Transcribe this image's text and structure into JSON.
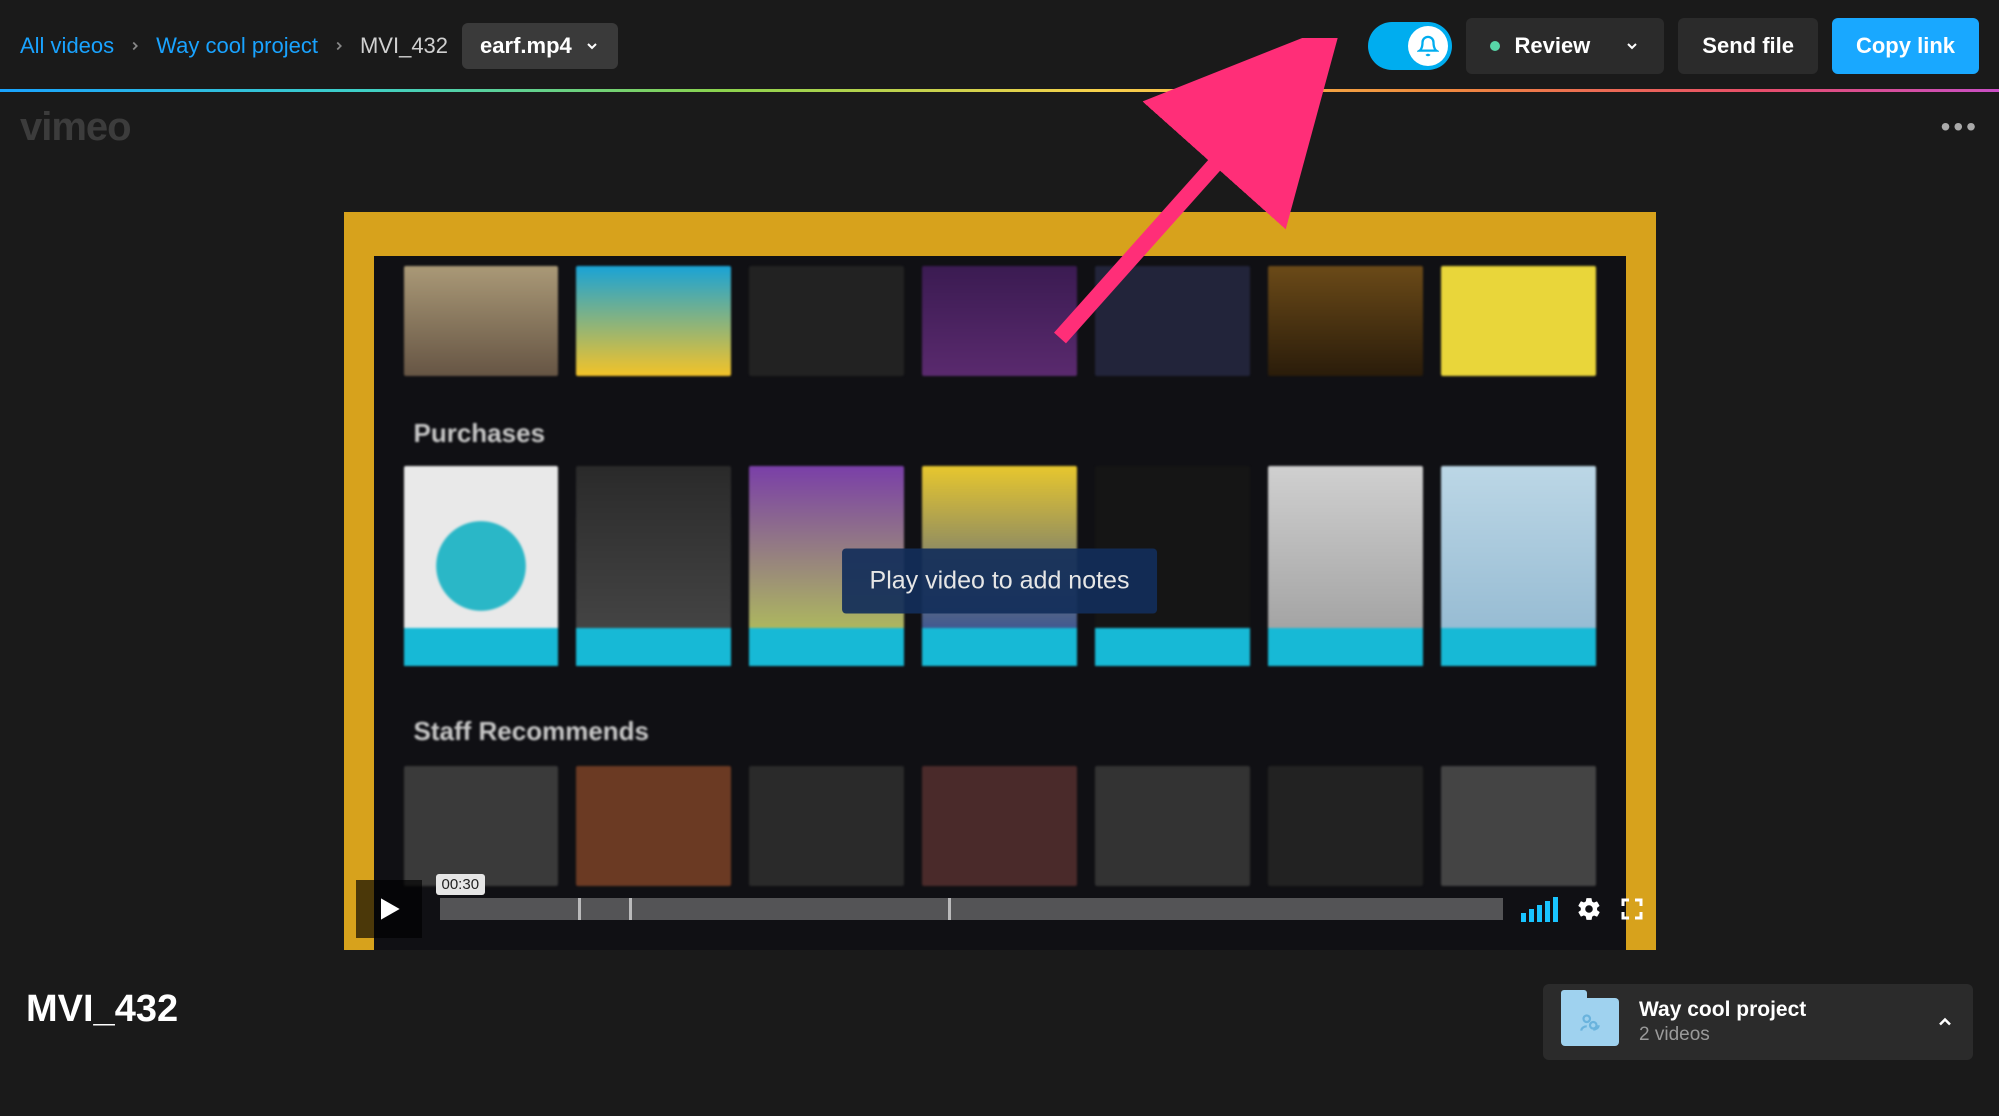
{
  "breadcrumb": {
    "root": "All videos",
    "project": "Way cool project",
    "item": "MVI_432",
    "file": "earf.mp4"
  },
  "topbar": {
    "review_label": "Review",
    "send_file_label": "Send file",
    "copy_link_label": "Copy link"
  },
  "logo": {
    "text": "vimeo"
  },
  "player": {
    "overlay_text": "Play video to add notes",
    "time_label": "00:30",
    "inner_labels": {
      "purchases": "Purchases",
      "staff": "Staff Recommends"
    }
  },
  "video": {
    "title": "MVI_432"
  },
  "project_card": {
    "name": "Way cool project",
    "count": "2 videos"
  }
}
